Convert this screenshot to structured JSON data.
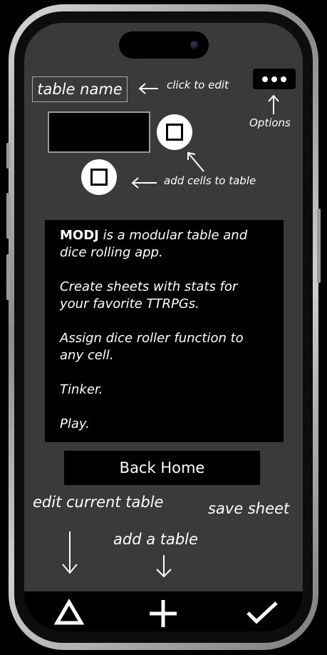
{
  "screen": {
    "table_name": "table name",
    "click_to_edit": "click to edit",
    "options_label": "Options",
    "add_cells_label": "add cells to table"
  },
  "info": {
    "brand": "MODJ",
    "intro_rest": " is a modular table and dice rolling app.",
    "line_sheets": "Create sheets with stats for your favorite TTRPGs.",
    "line_dice": "Assign dice roller function to any cell.",
    "line_tinker": "Tinker.",
    "line_play": "Play."
  },
  "buttons": {
    "back_home": "Back Home"
  },
  "annotations": {
    "edit_current_table": "edit current table",
    "save_sheet": "save sheet",
    "add_a_table": "add a table"
  },
  "bottom_nav": {
    "edit_icon": "triangle-icon",
    "add_icon": "plus-icon",
    "save_icon": "check-icon"
  },
  "colors": {
    "screen_bg": "#3a3a3a",
    "panel_bg": "#000000",
    "text": "#ffffff"
  }
}
